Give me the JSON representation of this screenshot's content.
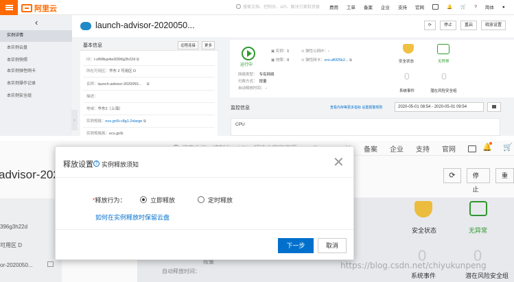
{
  "top": {
    "brand": "阿里云",
    "search_placeholder": "搜索文档、控制台、API、解决方案和资源",
    "nav": [
      "费用",
      "工单",
      "备案",
      "企业",
      "支持",
      "官网"
    ],
    "lang": "简体",
    "sidebar": {
      "items": [
        "实例详情",
        "本实例云盘",
        "本实例快照",
        "本实例弹性网卡",
        "本实例操作记录",
        "本实例安全组"
      ]
    },
    "instance_title": "launch-advisor-2020050...",
    "header_buttons": [
      "停止",
      "重启",
      "释放设置"
    ],
    "basic": {
      "title": "基本信息",
      "link1": "远程连接",
      "link2": "更多",
      "id_label": "ID：",
      "id_value": "i-uf68tup4w3l396g3h22d",
      "zone_label": "所在可用区：",
      "zone_value": "华东 2 可用区 D",
      "name_label": "名称：",
      "name_value": "launch-advisor-2020050...",
      "desc_label": "描述：",
      "region_label": "地域：",
      "region_value": "华东2（上海）",
      "spec_label": "实例规格：",
      "spec_value": "ecs.gn5i-c8g1.2xlarge",
      "family_label": "实例规格族：",
      "family_value": "ecs.gn5i"
    },
    "status": {
      "running": "运行中",
      "cpu_label": "实例：",
      "cpu_value": "1",
      "ip_label": "弹性公网IP：",
      "ip_value": "-",
      "lock_label": "快照：",
      "lock_value": "0",
      "nic_label": "弹性网卡：",
      "nic_value": "eni-uf6f25k2...",
      "net_type_label": "网络类型：",
      "net_type_value": "专有网络",
      "pay_label": "付费方式：",
      "pay_value": "按量",
      "auto_release_label": "自动释放时间：",
      "auto_release_value": "-",
      "safe_label": "安全状态",
      "noab_label": "无异常",
      "events_num": "0",
      "events_label": "系统事件",
      "risk_num": "0",
      "risk_label": "潜在风险安全组"
    },
    "monitor": {
      "title": "监控信息",
      "link": "查看内存等更多指标 设置报警规则",
      "range": "2020-05-01 08:54  -  2020-05-01 09:54",
      "cpu": "CPU"
    }
  },
  "bottom": {
    "search_placeholder": "搜索文档、控制台、API、解决方案和资源",
    "nav": [
      "费用",
      "工单",
      "备案",
      "企业",
      "支持",
      "官网"
    ],
    "title_partial": "advisor-202",
    "buttons": [
      "停止",
      "重"
    ],
    "left_text_1": "396g3h22d",
    "left_text_2": "可用区 D",
    "left_text_3": "or-2020050...",
    "safe_label": "安全状态",
    "noab_label": "无异常",
    "events_num": "0",
    "risk_num": "0",
    "events_label": "系统事件",
    "risk_label": "潜在风险安全组",
    "pay_value": "按量",
    "auto_release_label": "自动释放时间：",
    "watermark": "https://blog.csdn.net/chiyukunpeng",
    "modal": {
      "title": "释放设置",
      "notice": "实例释放须知",
      "field_label": "释放行为：",
      "option_now": "立即释放",
      "option_timed": "定时释放",
      "selected": "立即释放",
      "help_link": "如何在实例释放时保留云盘",
      "next": "下一步",
      "cancel": "取消"
    }
  },
  "colors": {
    "brand_orange": "#ff6a00",
    "primary_blue": "#0070cc",
    "success_green": "#2e9a2e"
  }
}
